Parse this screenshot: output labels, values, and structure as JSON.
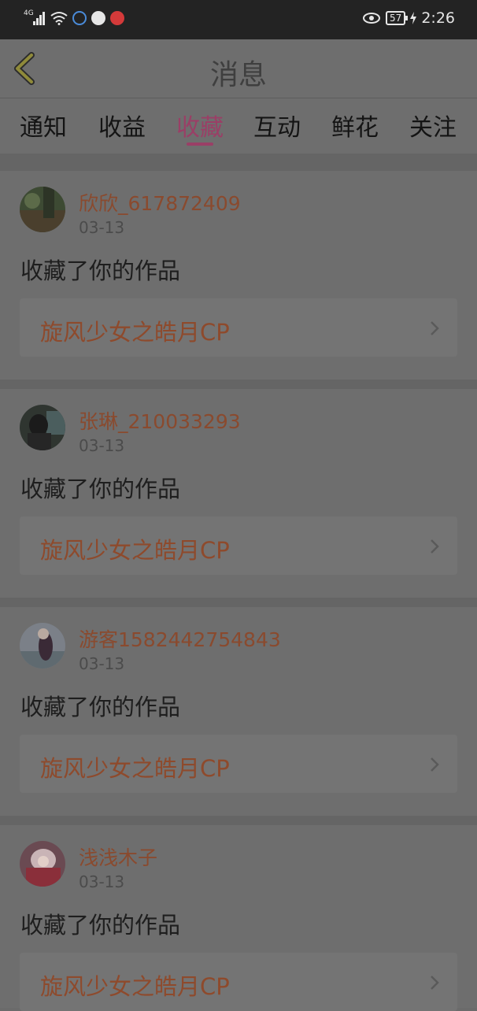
{
  "status_bar": {
    "network": "4G",
    "battery": "57",
    "time": "2:26"
  },
  "header": {
    "title": "消息"
  },
  "tabs": [
    {
      "label": "通知"
    },
    {
      "label": "收益"
    },
    {
      "label": "收藏",
      "active": true
    },
    {
      "label": "互动"
    },
    {
      "label": "鲜花"
    },
    {
      "label": "关注"
    }
  ],
  "messages": [
    {
      "username": "欣欣_617872409",
      "date": "03-13",
      "action": "收藏了你的作品",
      "work_title": "旋风少女之皓月CP"
    },
    {
      "username": "张琳_210033293",
      "date": "03-13",
      "action": "收藏了你的作品",
      "work_title": "旋风少女之皓月CP"
    },
    {
      "username": "游客1582442754843",
      "date": "03-13",
      "action": "收藏了你的作品",
      "work_title": "旋风少女之皓月CP"
    },
    {
      "username": "浅浅木子",
      "date": "03-13",
      "action": "收藏了你的作品",
      "work_title": "旋风少女之皓月CP"
    }
  ]
}
